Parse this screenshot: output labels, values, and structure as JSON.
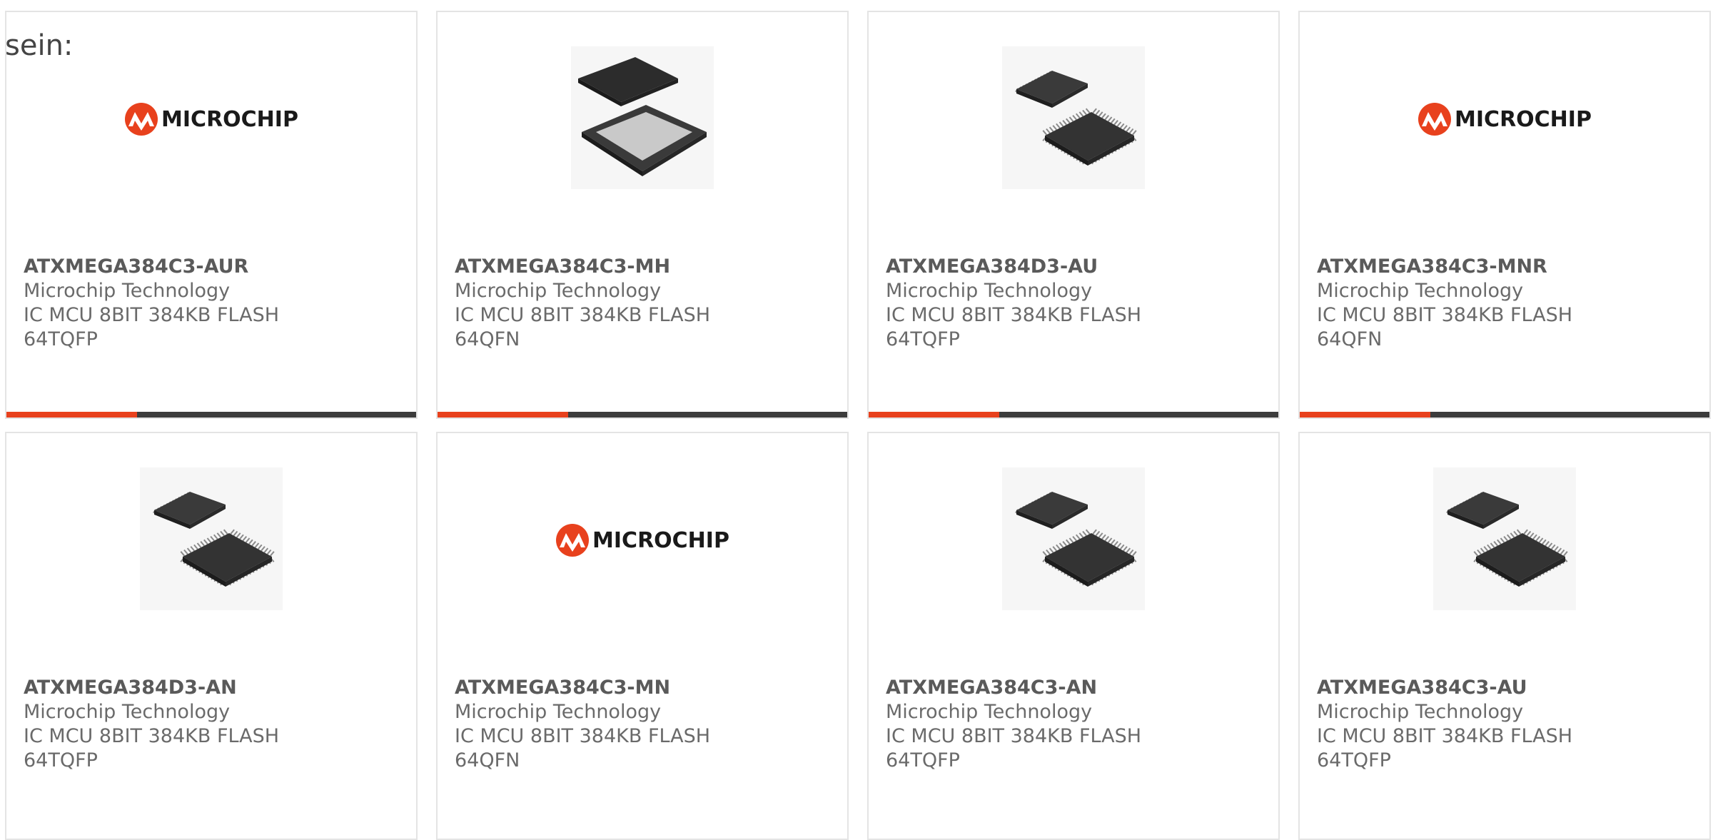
{
  "intro_text": "sein:",
  "colors": {
    "accent": "#e8411d",
    "bar": "#3c3c3c",
    "card_border": "#e4e4e4",
    "text": "#6a6a6a"
  },
  "products": [
    {
      "part": "ATXMEGA384C3-AUR",
      "maker": "Microchip Technology",
      "desc": "IC MCU 8BIT 384KB FLASH",
      "pkg": "64TQFP",
      "image": "microchip-logo",
      "has_bar": true
    },
    {
      "part": "ATXMEGA384C3-MH",
      "maker": "Microchip Technology",
      "desc": "IC MCU 8BIT 384KB FLASH",
      "pkg": "64QFN",
      "image": "qfn-chip",
      "has_bar": true
    },
    {
      "part": "ATXMEGA384D3-AU",
      "maker": "Microchip Technology",
      "desc": "IC MCU 8BIT 384KB FLASH",
      "pkg": "64TQFP",
      "image": "tqfp-chip",
      "has_bar": true
    },
    {
      "part": "ATXMEGA384C3-MNR",
      "maker": "Microchip Technology",
      "desc": "IC MCU 8BIT 384KB FLASH",
      "pkg": "64QFN",
      "image": "microchip-logo",
      "has_bar": true
    },
    {
      "part": "ATXMEGA384D3-AN",
      "maker": "Microchip Technology",
      "desc": "IC MCU 8BIT 384KB FLASH",
      "pkg": "64TQFP",
      "image": "tqfp-chip",
      "has_bar": false
    },
    {
      "part": "ATXMEGA384C3-MN",
      "maker": "Microchip Technology",
      "desc": "IC MCU 8BIT 384KB FLASH",
      "pkg": "64QFN",
      "image": "microchip-logo",
      "has_bar": false
    },
    {
      "part": "ATXMEGA384C3-AN",
      "maker": "Microchip Technology",
      "desc": "IC MCU 8BIT 384KB FLASH",
      "pkg": "64TQFP",
      "image": "tqfp-chip",
      "has_bar": false
    },
    {
      "part": "ATXMEGA384C3-AU",
      "maker": "Microchip Technology",
      "desc": "IC MCU 8BIT 384KB FLASH",
      "pkg": "64TQFP",
      "image": "tqfp-chip",
      "has_bar": false
    }
  ],
  "logo_word": "MICROCHIP"
}
